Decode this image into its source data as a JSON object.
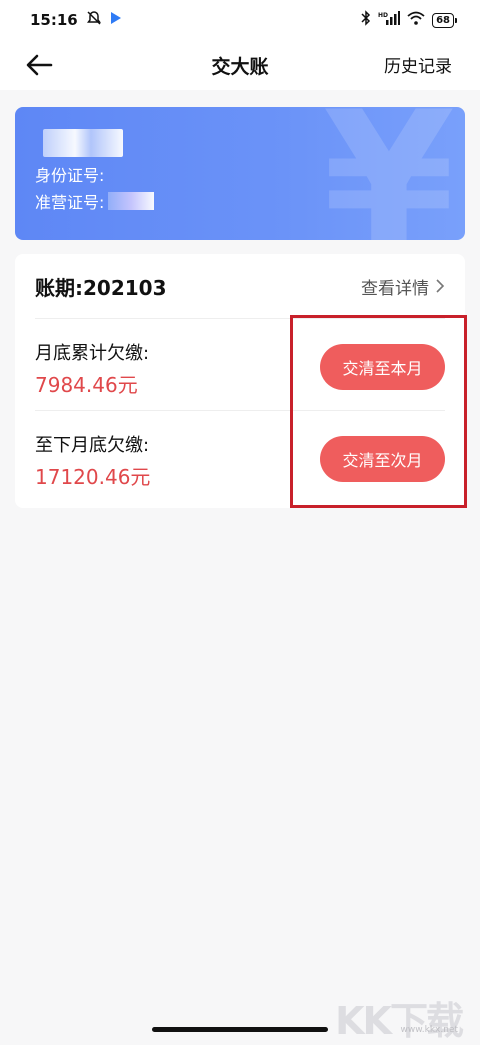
{
  "status_bar": {
    "time": "15:16",
    "battery": "68",
    "icons": [
      "mute-bell-icon",
      "play-icon",
      "bluetooth-icon",
      "hd-signal-icon",
      "wifi-icon",
      "battery-icon"
    ]
  },
  "nav": {
    "title": "交大账",
    "history_label": "历史记录",
    "back_icon": "back-arrow-icon"
  },
  "info_card": {
    "id_label": "身份证号:",
    "license_label": "准营证号:",
    "watermark_glyph": "¥",
    "color": "#6a8ff7"
  },
  "bill": {
    "period": "账期:202103",
    "detail_label": "查看详情",
    "rows": [
      {
        "label": "月底累计欠缴:",
        "amount": "7984.46元",
        "button": "交清至本月"
      },
      {
        "label": "至下月底欠缴:",
        "amount": "17120.46元",
        "button": "交清至次月"
      }
    ]
  },
  "watermark": {
    "logo": "KK下载",
    "url": "www.kkx.net"
  },
  "colors": {
    "accent_red": "#ef5d5d",
    "amount_red": "#e0484b",
    "card_blue": "#6a8ff7",
    "highlight": "#c8202a"
  }
}
